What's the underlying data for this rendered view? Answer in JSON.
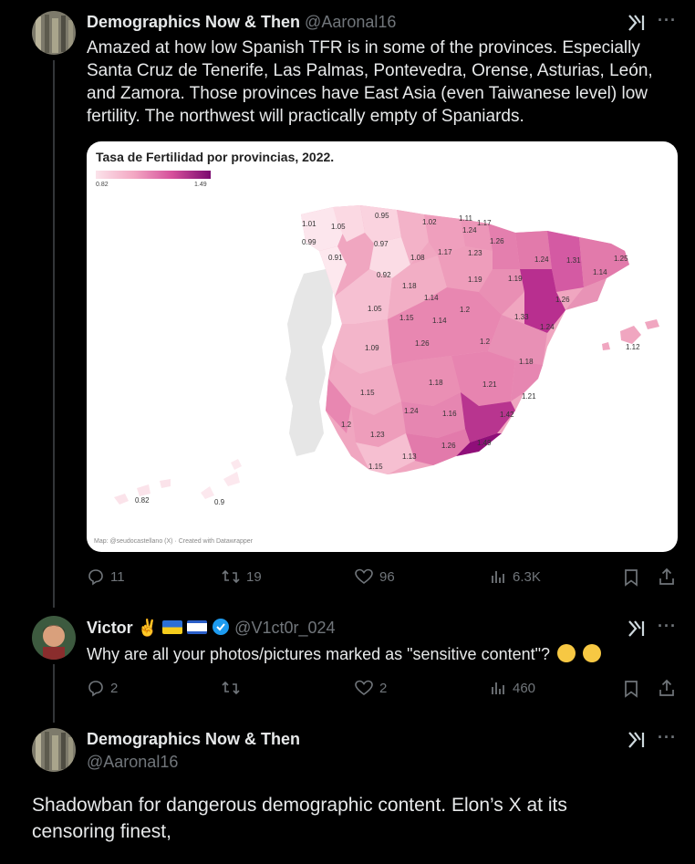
{
  "tweets": [
    {
      "author_name": "Demographics Now & Then",
      "handle": "@Aaronal16",
      "text": "Amazed at how low Spanish TFR is in some of the provinces.  Especially Santa Cruz de Tenerife, Las Palmas, Pontevedra, Orense, Asturias, León, and Zamora.  Those provinces have East Asia (even Taiwanese level) low fertility.  The northwest will practically empty of Spaniards.",
      "replies": "11",
      "reposts": "19",
      "likes": "96",
      "views": "6.3K"
    },
    {
      "author_name": "Victor ✌️",
      "handle": "@V1ct0r_024",
      "text": "Why are all your photos/pictures marked as \"sensitive content\"?",
      "replies": "2",
      "reposts": "",
      "likes": "2",
      "views": "460"
    },
    {
      "author_name": "Demographics Now & Then",
      "handle": "@Aaronal16",
      "text": "Shadowban for dangerous demographic content.  Elon’s X at its censoring finest,"
    }
  ],
  "map": {
    "title": "Tasa de Fertilidad por provincias, 2022.",
    "legend_min": "0.82",
    "legend_max": "1.49",
    "credit": "Map: @seudocastellano (X) · Created with Datawrapper",
    "values": [
      "1.01",
      "1.05",
      "0.95",
      "1.02",
      "1.11",
      "1.17",
      "0.99",
      "0.97",
      "1.24",
      "1.26",
      "0.91",
      "1.08",
      "1.17",
      "1.23",
      "1.24",
      "1.31",
      "1.25",
      "0.92",
      "1.19",
      "1.19",
      "1.14",
      "1.18",
      "1.14",
      "1.26",
      "1.05",
      "1.2",
      "1.33",
      "1.15",
      "1.14",
      "1.24",
      "1.09",
      "1.26",
      "1.2",
      "1.12",
      "1.18",
      "1.15",
      "1.18",
      "1.21",
      "1.21",
      "1.24",
      "1.16",
      "1.42",
      "1.2",
      "1.23",
      "1.26",
      "1.49",
      "1.13",
      "1.15",
      "0.82",
      "0.9"
    ]
  }
}
